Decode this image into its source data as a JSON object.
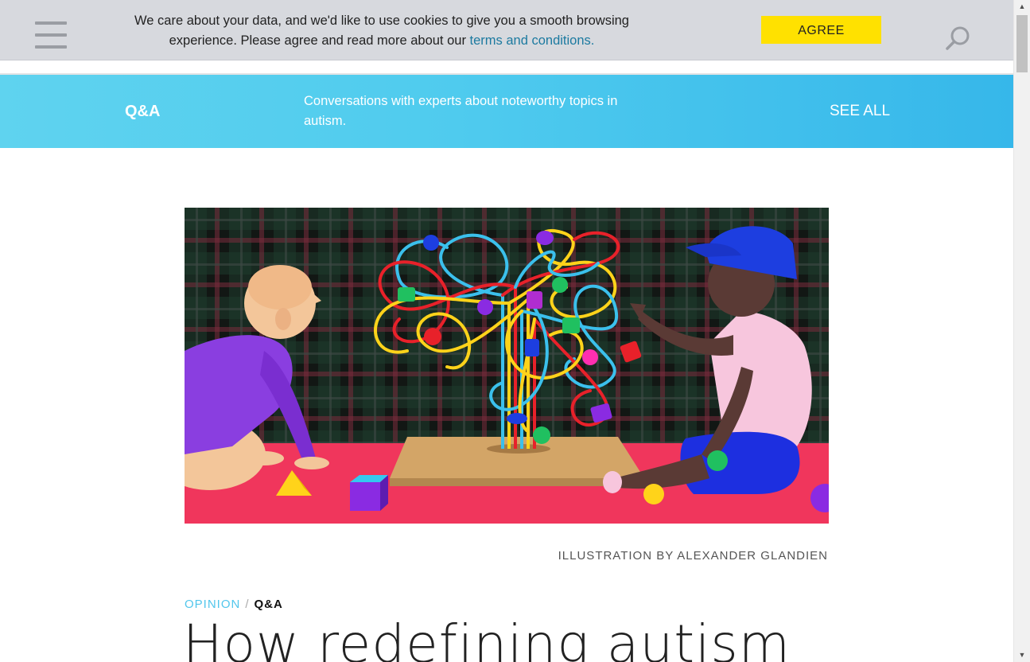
{
  "cookie_bar": {
    "text_part1": "We care about your data, and we'd like to use cookies to give you a smooth browsing experience. Please agree and read more about our ",
    "link_text": "terms and conditions.",
    "agree_label": "AGREE"
  },
  "header": {
    "menu_icon": "hamburger-menu-icon",
    "search_icon": "search-icon"
  },
  "banner": {
    "label": "Q&A",
    "description": "Conversations with experts about noteworthy topics in autism.",
    "see_all": "SEE ALL"
  },
  "article": {
    "caption": "ILLUSTRATION BY ALEXANDER GLANDIEN",
    "breadcrumb_section": "OPINION",
    "breadcrumb_separator": "/",
    "breadcrumb_category": "Q&A",
    "title": "How redefining autism"
  },
  "colors": {
    "accent_blue": "#4fcbee",
    "agree_yellow": "#ffe100",
    "link_blue": "#1c7aa0",
    "cookie_bg": "#d7d9de",
    "floor_pink": "#f0365c"
  }
}
